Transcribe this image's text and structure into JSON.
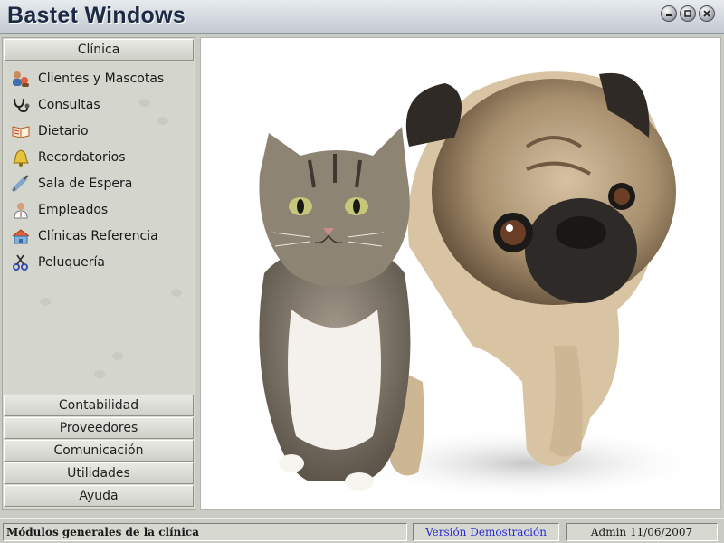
{
  "window": {
    "title": "Bastet Windows",
    "controls": [
      "minimize-icon",
      "maximize-icon",
      "close-icon"
    ]
  },
  "sidebar": {
    "active_section": "Clínica",
    "items": [
      {
        "label": "Clientes y Mascotas",
        "icon": "people-pet-icon"
      },
      {
        "label": "Consultas",
        "icon": "stethoscope-icon"
      },
      {
        "label": "Dietario",
        "icon": "book-icon"
      },
      {
        "label": "Recordatorios",
        "icon": "bell-icon"
      },
      {
        "label": "Sala de Espera",
        "icon": "syringe-icon"
      },
      {
        "label": "Empleados",
        "icon": "doctor-icon"
      },
      {
        "label": "Clínicas Referencia",
        "icon": "clinic-icon"
      },
      {
        "label": "Peluquería",
        "icon": "scissors-icon"
      }
    ],
    "sections": [
      "Contabilidad",
      "Proveedores",
      "Comunicación",
      "Utilidades",
      "Ayuda"
    ]
  },
  "main_image": {
    "description_icon": "cat-and-pug-image"
  },
  "statusbar": {
    "module": "Módulos generales de la clínica",
    "version": "Versión Demostración",
    "user_date": "Admin 11/06/2007"
  },
  "colors": {
    "version_text": "#2a2bd6",
    "title_text": "#1c2a44"
  }
}
